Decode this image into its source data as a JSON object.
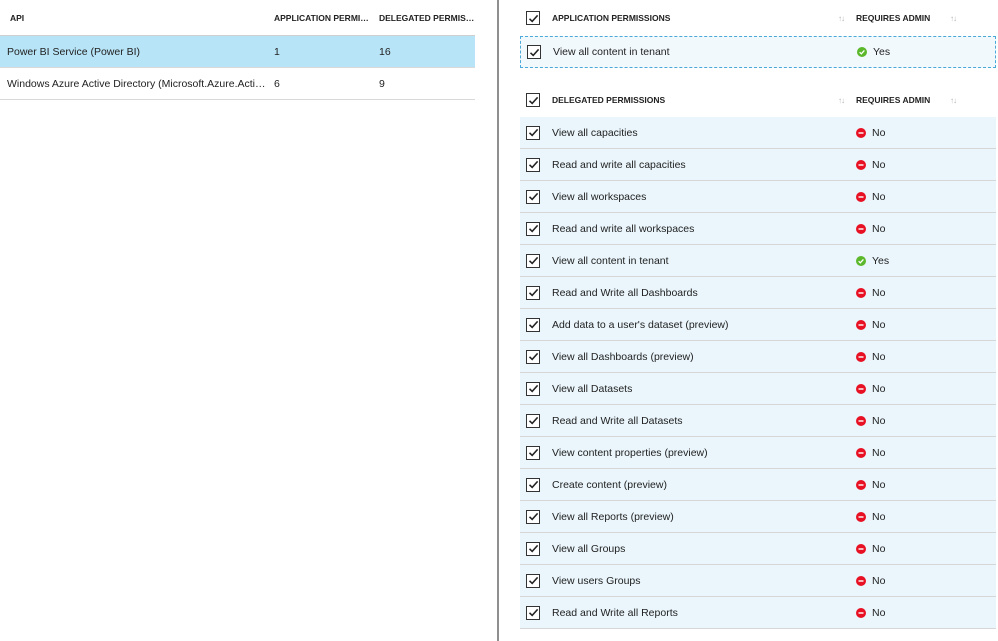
{
  "api_table": {
    "headers": {
      "api": "API",
      "app_perms": "APPLICATION PERMISSIONS",
      "delegated_perms": "DELEGATED PERMISSIONS"
    },
    "rows": [
      {
        "api": "Power BI Service (Power BI)",
        "app": "1",
        "delegated": "16",
        "selected": true
      },
      {
        "api": "Windows Azure Active Directory (Microsoft.Azure.ActiveDirectory)",
        "app": "6",
        "delegated": "9",
        "selected": false
      }
    ]
  },
  "app_section": {
    "header": "APPLICATION PERMISSIONS",
    "admin_header": "REQUIRES ADMIN",
    "rows": [
      {
        "label": "View all content in tenant",
        "admin": "Yes"
      }
    ]
  },
  "delegated_section": {
    "header": "DELEGATED PERMISSIONS",
    "admin_header": "REQUIRES ADMIN",
    "rows": [
      {
        "label": "View all capacities",
        "admin": "No"
      },
      {
        "label": "Read and write all capacities",
        "admin": "No"
      },
      {
        "label": "View all workspaces",
        "admin": "No"
      },
      {
        "label": "Read and write all workspaces",
        "admin": "No"
      },
      {
        "label": "View all content in tenant",
        "admin": "Yes"
      },
      {
        "label": "Read and Write all Dashboards",
        "admin": "No"
      },
      {
        "label": "Add data to a user's dataset (preview)",
        "admin": "No"
      },
      {
        "label": "View all Dashboards (preview)",
        "admin": "No"
      },
      {
        "label": "View all Datasets",
        "admin": "No"
      },
      {
        "label": "Read and Write all Datasets",
        "admin": "No"
      },
      {
        "label": "View content properties (preview)",
        "admin": "No"
      },
      {
        "label": "Create content (preview)",
        "admin": "No"
      },
      {
        "label": "View all Reports (preview)",
        "admin": "No"
      },
      {
        "label": "View all Groups",
        "admin": "No"
      },
      {
        "label": "View users Groups",
        "admin": "No"
      },
      {
        "label": "Read and Write all Reports",
        "admin": "No"
      }
    ]
  },
  "colors": {
    "selected_row": "#b8e4f7",
    "perm_row": "#eaf6fc",
    "yes": "#5cb82b",
    "no": "#e81123"
  },
  "icons": {
    "checkbox": "checkmark-icon",
    "sort": "sort-arrows-icon",
    "yes": "check-circle-icon",
    "no": "minus-circle-icon"
  }
}
